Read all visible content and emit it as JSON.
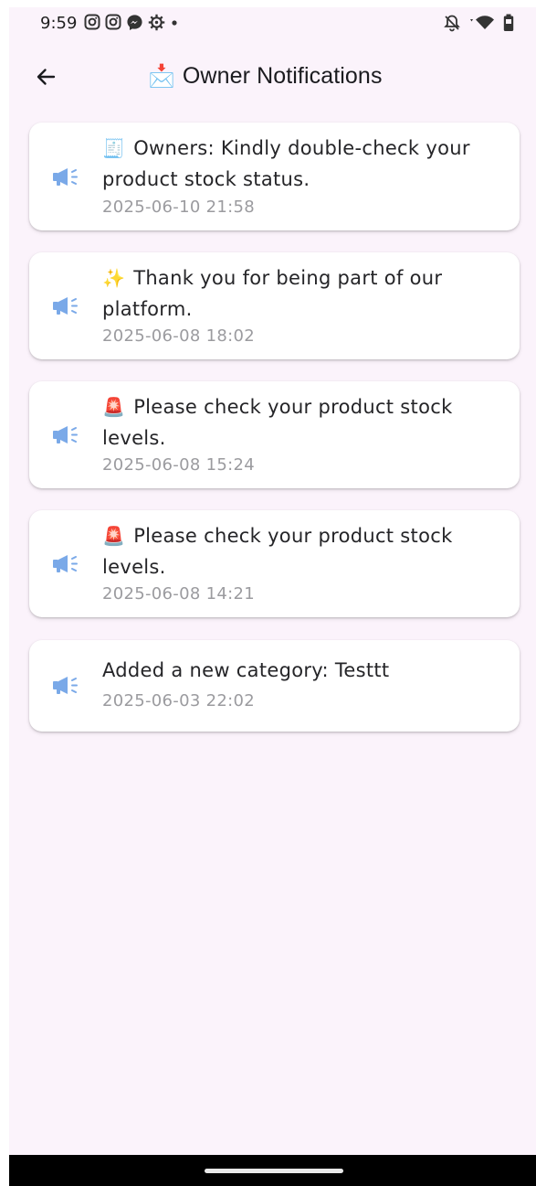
{
  "status_bar": {
    "time": "9:59",
    "app_icons": [
      "instagram-icon",
      "instagram-icon",
      "messenger-icon",
      "settings-gear-icon",
      "dot-icon"
    ],
    "system_icons": [
      "bell-off-icon",
      "wifi-icon",
      "battery-icon"
    ]
  },
  "app_bar": {
    "title_emoji": "📩",
    "title": "Owner Notifications",
    "back_icon": "arrow-left-icon"
  },
  "notifications": [
    {
      "emoji": "🧾",
      "message": "Owners: Kindly double-check your product stock status.",
      "timestamp": "2025-06-10 21:58",
      "icon": "megaphone-icon"
    },
    {
      "emoji": "✨",
      "message": "Thank you for being part of our platform.",
      "timestamp": "2025-06-08 18:02",
      "icon": "megaphone-icon"
    },
    {
      "emoji": "🚨",
      "message": "Please check your product stock levels.",
      "timestamp": "2025-06-08 15:24",
      "icon": "megaphone-icon"
    },
    {
      "emoji": "🚨",
      "message": "Please check your product stock levels.",
      "timestamp": "2025-06-08 14:21",
      "icon": "megaphone-icon"
    },
    {
      "emoji": "",
      "message": "Added a new category: Testtt",
      "timestamp": "2025-06-03 22:02",
      "icon": "megaphone-icon"
    }
  ],
  "colors": {
    "background": "#fbf3fb",
    "card": "#ffffff",
    "megaphone": "#7aa9e8",
    "timestamp": "#9b9b9f",
    "text": "#252528"
  }
}
